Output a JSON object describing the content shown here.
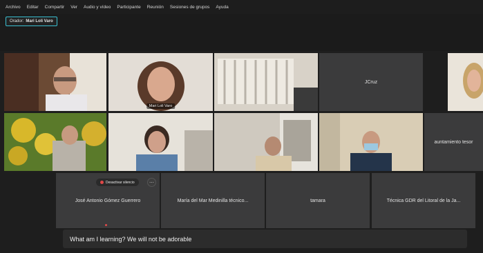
{
  "menu": [
    "Archivo",
    "Editar",
    "Compartir",
    "Ver",
    "Audio y vídeo",
    "Participante",
    "Reunión",
    "Sesiones de grupos",
    "Ayuda"
  ],
  "presenter": {
    "label": "Orador:",
    "name": "Mari Loli Varo"
  },
  "tiles": {
    "jcruz": "JCruz",
    "mari_loli": "Mari Loli Varo",
    "ayuntamiento": "auntamiento tesor",
    "jose_antonio": "José Antonio Gómez Guerrero",
    "maria_mar": "María del Mar Medinilla técnico...",
    "tamara": "tamara",
    "tecnica": "Técnica GDR del Litoral de la Ja..."
  },
  "controls": {
    "mute_label": "Desactivar silencio",
    "more": "⋯"
  },
  "caption": "What am I learning? We will not be adorable",
  "colors": {
    "accent": "#3ac0d2",
    "mic_muted": "#e04848",
    "tile_bg": "#3b3b3c"
  }
}
